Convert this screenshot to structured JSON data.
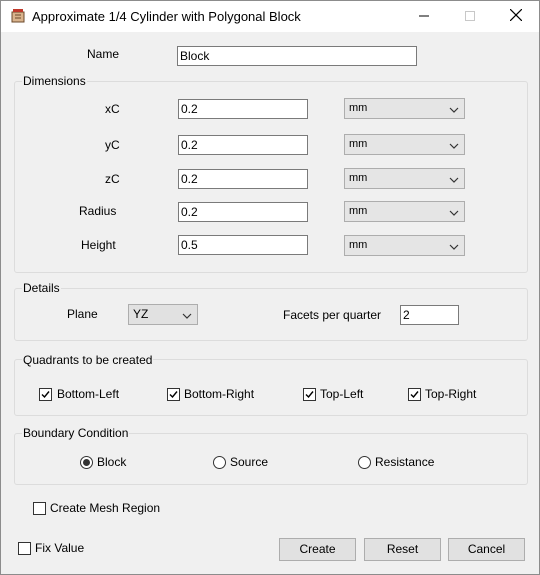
{
  "window": {
    "title": "Approximate 1/4 Cylinder with Polygonal Block",
    "app_icon": "app-icon",
    "minimize_icon": "minimize-icon",
    "maximize_icon": "maximize-icon",
    "close_icon": "close-icon"
  },
  "name_field": {
    "label": "Name",
    "value": "Block"
  },
  "dimensions": {
    "title": "Dimensions",
    "rows": [
      {
        "label": "xC",
        "value": "0.2",
        "unit": "mm"
      },
      {
        "label": "yC",
        "value": "0.2",
        "unit": "mm"
      },
      {
        "label": "zC",
        "value": "0.2",
        "unit": "mm"
      },
      {
        "label": "Radius",
        "value": "0.2",
        "unit": "mm"
      },
      {
        "label": "Height",
        "value": "0.5",
        "unit": "mm"
      }
    ]
  },
  "details": {
    "title": "Details",
    "plane_label": "Plane",
    "plane_value": "YZ",
    "facets_label": "Facets per quarter",
    "facets_value": "2"
  },
  "quadrants": {
    "title": "Quadrants to be created",
    "items": [
      {
        "label": "Bottom-Left",
        "checked": true
      },
      {
        "label": "Bottom-Right",
        "checked": true
      },
      {
        "label": "Top-Left",
        "checked": true
      },
      {
        "label": "Top-Right",
        "checked": true
      }
    ]
  },
  "boundary": {
    "title": "Boundary Condition",
    "options": [
      {
        "label": "Block",
        "selected": true
      },
      {
        "label": "Source",
        "selected": false
      },
      {
        "label": "Resistance",
        "selected": false
      }
    ]
  },
  "create_mesh_region": {
    "label": "Create Mesh Region",
    "checked": false
  },
  "fix_value": {
    "label": "Fix Value",
    "checked": false
  },
  "buttons": {
    "create": "Create",
    "reset": "Reset",
    "cancel": "Cancel"
  }
}
